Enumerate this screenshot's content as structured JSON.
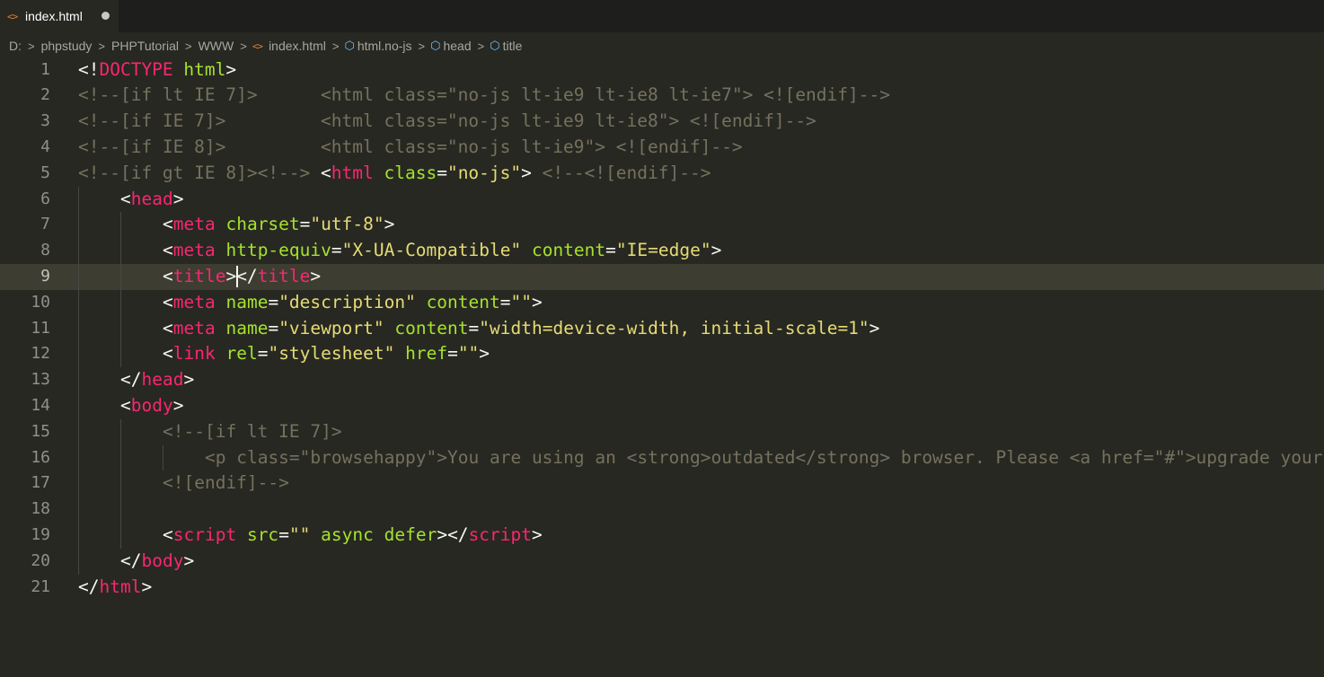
{
  "tab": {
    "icon": "html-file-icon",
    "label": "index.html",
    "modified": true
  },
  "breadcrumb": {
    "items": [
      "D:",
      "phpstudy",
      "PHPTutorial",
      "WWW",
      "index.html",
      "html.no-js",
      "head",
      "title"
    ]
  },
  "editor": {
    "current_line": 9,
    "lines": [
      {
        "n": "1",
        "indent": 0,
        "tokens": [
          [
            "p",
            "<!"
          ],
          [
            "t",
            "DOCTYPE"
          ],
          [
            "p",
            " "
          ],
          [
            "a",
            "html"
          ],
          [
            "p",
            ">"
          ]
        ]
      },
      {
        "n": "2",
        "indent": 0,
        "tokens": [
          [
            "c",
            "<!--[if lt IE 7]>      <html class=\"no-js lt-ie9 lt-ie8 lt-ie7\"> <![endif]-->"
          ]
        ]
      },
      {
        "n": "3",
        "indent": 0,
        "tokens": [
          [
            "c",
            "<!--[if IE 7]>         <html class=\"no-js lt-ie9 lt-ie8\"> <![endif]-->"
          ]
        ]
      },
      {
        "n": "4",
        "indent": 0,
        "tokens": [
          [
            "c",
            "<!--[if IE 8]>         <html class=\"no-js lt-ie9\"> <![endif]-->"
          ]
        ]
      },
      {
        "n": "5",
        "indent": 0,
        "tokens": [
          [
            "c",
            "<!--[if gt IE 8]><!--> "
          ],
          [
            "p",
            "<"
          ],
          [
            "t",
            "html"
          ],
          [
            "p",
            " "
          ],
          [
            "a",
            "class"
          ],
          [
            "p",
            "="
          ],
          [
            "s",
            "\"no-js\""
          ],
          [
            "p",
            "> "
          ],
          [
            "c",
            "<!--<![endif]-->"
          ]
        ]
      },
      {
        "n": "6",
        "indent": 1,
        "tokens": [
          [
            "p",
            "<"
          ],
          [
            "t",
            "head"
          ],
          [
            "p",
            ">"
          ]
        ]
      },
      {
        "n": "7",
        "indent": 2,
        "tokens": [
          [
            "p",
            "<"
          ],
          [
            "t",
            "meta"
          ],
          [
            "p",
            " "
          ],
          [
            "a",
            "charset"
          ],
          [
            "p",
            "="
          ],
          [
            "s",
            "\"utf-8\""
          ],
          [
            "p",
            ">"
          ]
        ]
      },
      {
        "n": "8",
        "indent": 2,
        "tokens": [
          [
            "p",
            "<"
          ],
          [
            "t",
            "meta"
          ],
          [
            "p",
            " "
          ],
          [
            "a",
            "http-equiv"
          ],
          [
            "p",
            "="
          ],
          [
            "s",
            "\"X-UA-Compatible\""
          ],
          [
            "p",
            " "
          ],
          [
            "a",
            "content"
          ],
          [
            "p",
            "="
          ],
          [
            "s",
            "\"IE=edge\""
          ],
          [
            "p",
            ">"
          ]
        ]
      },
      {
        "n": "9",
        "indent": 2,
        "tokens": [
          [
            "p",
            "<"
          ],
          [
            "t",
            "title"
          ],
          [
            "p",
            "></"
          ],
          [
            "t",
            "title"
          ],
          [
            "p",
            ">"
          ]
        ]
      },
      {
        "n": "10",
        "indent": 2,
        "tokens": [
          [
            "p",
            "<"
          ],
          [
            "t",
            "meta"
          ],
          [
            "p",
            " "
          ],
          [
            "a",
            "name"
          ],
          [
            "p",
            "="
          ],
          [
            "s",
            "\"description\""
          ],
          [
            "p",
            " "
          ],
          [
            "a",
            "content"
          ],
          [
            "p",
            "="
          ],
          [
            "s",
            "\"\""
          ],
          [
            "p",
            ">"
          ]
        ]
      },
      {
        "n": "11",
        "indent": 2,
        "tokens": [
          [
            "p",
            "<"
          ],
          [
            "t",
            "meta"
          ],
          [
            "p",
            " "
          ],
          [
            "a",
            "name"
          ],
          [
            "p",
            "="
          ],
          [
            "s",
            "\"viewport\""
          ],
          [
            "p",
            " "
          ],
          [
            "a",
            "content"
          ],
          [
            "p",
            "="
          ],
          [
            "s",
            "\"width=device-width, initial-scale=1\""
          ],
          [
            "p",
            ">"
          ]
        ]
      },
      {
        "n": "12",
        "indent": 2,
        "tokens": [
          [
            "p",
            "<"
          ],
          [
            "t",
            "link"
          ],
          [
            "p",
            " "
          ],
          [
            "a",
            "rel"
          ],
          [
            "p",
            "="
          ],
          [
            "s",
            "\"stylesheet\""
          ],
          [
            "p",
            " "
          ],
          [
            "a",
            "href"
          ],
          [
            "p",
            "="
          ],
          [
            "s",
            "\"\""
          ],
          [
            "p",
            ">"
          ]
        ]
      },
      {
        "n": "13",
        "indent": 1,
        "tokens": [
          [
            "p",
            "</"
          ],
          [
            "t",
            "head"
          ],
          [
            "p",
            ">"
          ]
        ]
      },
      {
        "n": "14",
        "indent": 1,
        "tokens": [
          [
            "p",
            "<"
          ],
          [
            "t",
            "body"
          ],
          [
            "p",
            ">"
          ]
        ]
      },
      {
        "n": "15",
        "indent": 2,
        "tokens": [
          [
            "c",
            "<!--[if lt IE 7]>"
          ]
        ]
      },
      {
        "n": "16",
        "indent": 3,
        "tokens": [
          [
            "c",
            "<p class=\"browsehappy\">You are using an <strong>outdated</strong> browser. Please <a href=\"#\">upgrade your browser</a>"
          ]
        ]
      },
      {
        "n": "17",
        "indent": 2,
        "tokens": [
          [
            "c",
            "<![endif]-->"
          ]
        ]
      },
      {
        "n": "18",
        "indent": 2,
        "tokens": []
      },
      {
        "n": "19",
        "indent": 2,
        "tokens": [
          [
            "p",
            "<"
          ],
          [
            "t",
            "script"
          ],
          [
            "p",
            " "
          ],
          [
            "a",
            "src"
          ],
          [
            "p",
            "="
          ],
          [
            "s",
            "\"\""
          ],
          [
            "p",
            " "
          ],
          [
            "a",
            "async"
          ],
          [
            "p",
            " "
          ],
          [
            "a",
            "defer"
          ],
          [
            "p",
            "></"
          ],
          [
            "t",
            "script"
          ],
          [
            "p",
            ">"
          ]
        ]
      },
      {
        "n": "20",
        "indent": 1,
        "tokens": [
          [
            "p",
            "</"
          ],
          [
            "t",
            "body"
          ],
          [
            "p",
            ">"
          ]
        ]
      },
      {
        "n": "21",
        "indent": 0,
        "tokens": [
          [
            "p",
            "</"
          ],
          [
            "t",
            "html"
          ],
          [
            "p",
            ">"
          ]
        ]
      }
    ]
  },
  "colors": {
    "background": "#272822",
    "tag": "#f92672",
    "attribute": "#a6e22e",
    "string": "#e6db74",
    "comment": "#75715e",
    "text": "#f8f8f2"
  }
}
